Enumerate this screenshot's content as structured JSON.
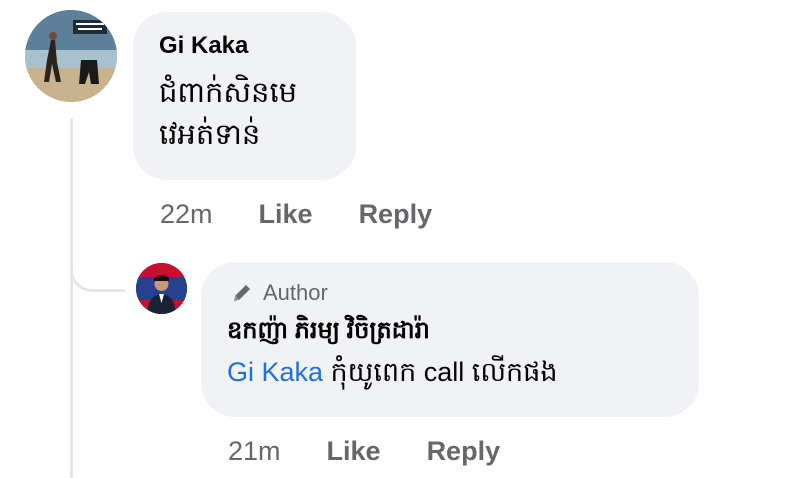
{
  "comment": {
    "author": "Gi Kaka",
    "text": "ជំពាក់សិនមេ វេអត់ទាន់",
    "time": "22m",
    "like_label": "Like",
    "reply_label": "Reply"
  },
  "reply": {
    "badge": "Author",
    "author": "ឧកញ៉ា ភិរម្យ វិចិត្រដារ៉ា",
    "mention": "Gi Kaka",
    "text": " កុំយូពេក call លើកផង",
    "time": "21m",
    "like_label": "Like",
    "reply_label": "Reply"
  },
  "colors": {
    "bubble": "#f0f2f5",
    "muted_text": "#65676b",
    "mention": "#216fdb",
    "thread_line": "#e4e6eb"
  },
  "icons": {
    "badge_icon": "pencil-icon"
  }
}
